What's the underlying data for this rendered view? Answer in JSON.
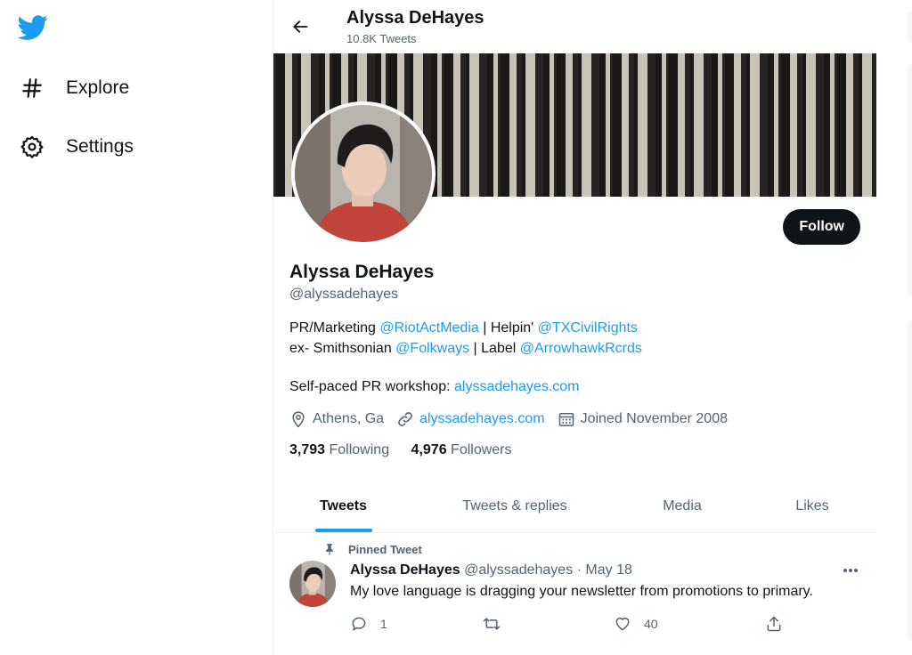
{
  "nav": {
    "items": [
      {
        "label": "Explore",
        "icon": "hashtag-icon"
      },
      {
        "label": "Settings",
        "icon": "gear-icon"
      }
    ]
  },
  "header": {
    "name": "Alyssa DeHayes",
    "tweet_count": "10.8K Tweets"
  },
  "profile": {
    "follow_label": "Follow",
    "name": "Alyssa DeHayes",
    "handle": "@alyssadehayes",
    "bio": {
      "line1": [
        {
          "text": "PR/Marketing ",
          "link": false
        },
        {
          "text": "@RiotActMedia",
          "link": true
        },
        {
          "text": " | Helpin' ",
          "link": false
        },
        {
          "text": "@TXCivilRights",
          "link": true
        }
      ],
      "line2": [
        {
          "text": "ex- Smithsonian ",
          "link": false
        },
        {
          "text": "@Folkways",
          "link": true
        },
        {
          "text": " | Label ",
          "link": false
        },
        {
          "text": "@ArrowhawkRcrds",
          "link": true
        }
      ]
    },
    "workshop_prefix": "Self-paced PR workshop: ",
    "workshop_link": "alyssadehayes.com",
    "location": "Athens, Ga",
    "website": "alyssadehayes.com",
    "joined": "Joined November 2008",
    "following_count": "3,793",
    "following_label": "Following",
    "followers_count": "4,976",
    "followers_label": "Followers"
  },
  "tabs": [
    "Tweets",
    "Tweets & replies",
    "Media",
    "Likes"
  ],
  "tweet": {
    "pinned_label": "Pinned Tweet",
    "author": "Alyssa DeHayes",
    "handle": "@alyssadehayes",
    "date": "· May 18",
    "text": "My love language is dragging your newsletter from promotions to primary.",
    "replies": "1",
    "likes": "40"
  },
  "colors": {
    "accent": "#1d9bf0",
    "text": "#0f1419",
    "muted": "#536471"
  }
}
